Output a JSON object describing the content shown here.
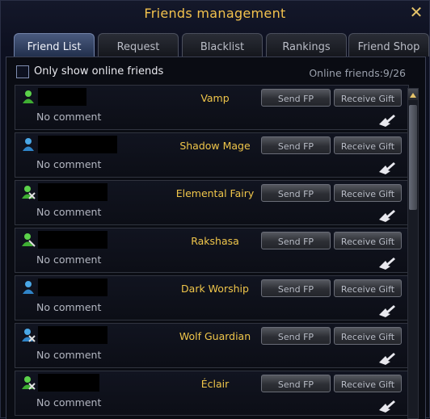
{
  "window": {
    "title": "Friends management",
    "close_label": "✕"
  },
  "tabs": [
    {
      "label": "Friend List",
      "active": true
    },
    {
      "label": "Request",
      "active": false
    },
    {
      "label": "Blacklist",
      "active": false
    },
    {
      "label": "Rankings",
      "active": false
    },
    {
      "label": "Friend Shop",
      "active": false
    }
  ],
  "filter": {
    "online_only_label": "Only show online friends",
    "online_only_checked": false,
    "online_count": "Online friends:9/26"
  },
  "buttons": {
    "send_fp": "Send FP",
    "receive_gift": "Receive Gift"
  },
  "friends": [
    {
      "char_name": "Vamp",
      "comment": "No comment",
      "icon": "green-person-icon"
    },
    {
      "char_name": "Shadow Mage",
      "comment": "No comment",
      "icon": "blue-person-icon"
    },
    {
      "char_name": "Elemental Fairy",
      "comment": "No comment",
      "icon": "green-person-swords-icon"
    },
    {
      "char_name": "Rakshasa",
      "comment": "No comment",
      "icon": "green-person-sword-icon"
    },
    {
      "char_name": "Dark Worship",
      "comment": "No comment",
      "icon": "blue-person-icon"
    },
    {
      "char_name": "Wolf Guardian",
      "comment": "No comment",
      "icon": "blue-person-swords-icon"
    },
    {
      "char_name": "Éclair",
      "comment": "No comment",
      "icon": "green-person-swords-icon"
    }
  ],
  "colors": {
    "accent_gold": "#f0c64a",
    "tab_active": "#4a5a7e"
  }
}
